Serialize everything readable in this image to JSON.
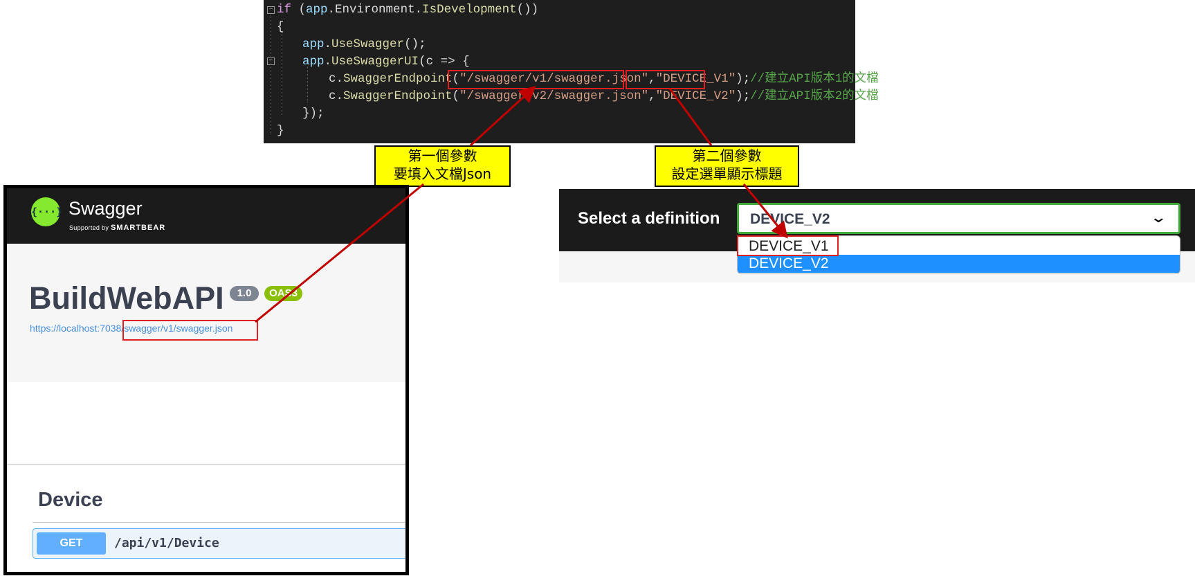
{
  "code": {
    "line1": {
      "kw": "if",
      "p1": " (",
      "id": "app",
      "p2": ".Environment.",
      "fn": "IsDevelopment",
      "p3": "())"
    },
    "line2": "{",
    "line3": {
      "id": "app",
      "p1": ".",
      "fn": "UseSwagger",
      "p2": "();"
    },
    "line4": {
      "id": "app",
      "p1": ".",
      "fn": "UseSwaggerUI",
      "p2": "(c => {"
    },
    "line5": {
      "p1": "c.",
      "fn": "SwaggerEndpoint",
      "p2": "(",
      "str1": "\"/swagger/v1/swagger.json\"",
      "p3": ",",
      "str2": "\"DEVICE_V1\"",
      "p4": ");",
      "cm": "//建立API版本1的文檔"
    },
    "line6": {
      "p1": "c.",
      "fn": "SwaggerEndpoint",
      "p2": "(",
      "str1": "\"/swagger/v2/swagger.json\"",
      "p3": ",",
      "str2": "\"DEVICE_V2\"",
      "p4": ");",
      "cm": "//建立API版本2的文檔"
    },
    "line7": "});",
    "line8": "}"
  },
  "callouts": {
    "first": {
      "line1": "第一個參數",
      "line2": "要填入文檔Json"
    },
    "second": {
      "line1": "第二個參數",
      "line2": "設定選單顯示標題"
    }
  },
  "swagger_left": {
    "logo_glyph": "{···}",
    "brand": "Swagger",
    "supported_by": "Supported by",
    "smartbear": "SMARTBEAR",
    "title": "BuildWebAPI",
    "version_badge": "1.0",
    "oas_badge": "OAS3",
    "url": "https://localhost:7038/swagger/v1/swagger.json",
    "tag": "Device",
    "method": "GET",
    "path": "/api/v1/Device"
  },
  "swagger_right": {
    "label": "Select a definition",
    "selected": "DEVICE_V2",
    "options": [
      "DEVICE_V1",
      "DEVICE_V2"
    ],
    "chevron_glyph": "⌄"
  },
  "colors": {
    "highlight": "#e02020",
    "callout_bg": "#ffff00",
    "get_method": "#61affe",
    "select_border": "#41a83a",
    "option_selected": "#1e90ff"
  }
}
